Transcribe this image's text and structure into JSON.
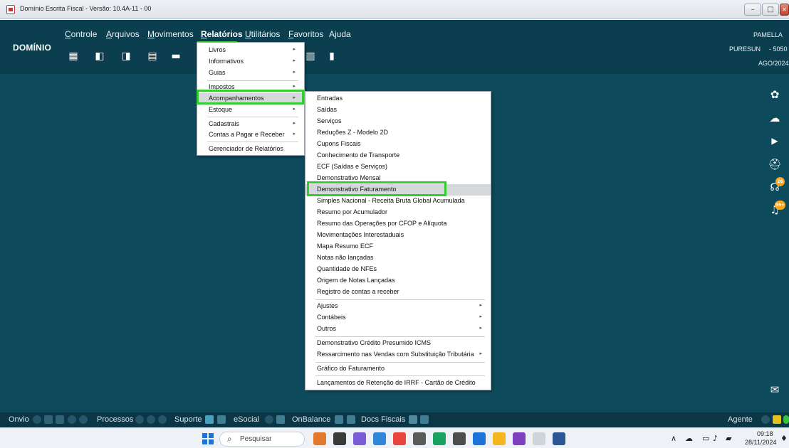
{
  "window": {
    "title": "Domínio Escrita Fiscal  - Versão: 10.4A-11 - 00",
    "min": "–",
    "max": "□",
    "close": "✕"
  },
  "brand": "DOMÍNIO",
  "menubar": [
    {
      "label": "Controle",
      "key": "C",
      "rest": "ontrole"
    },
    {
      "label": "Arquivos",
      "key": "A",
      "rest": "rquivos"
    },
    {
      "label": "Movimentos",
      "key": "M",
      "rest": "ovimentos"
    },
    {
      "label": "Relatórios",
      "key": "R",
      "rest": "elatórios",
      "active": true
    },
    {
      "label": "Utilitários",
      "key": "U",
      "rest": "tilitários"
    },
    {
      "label": "Favoritos",
      "key": "F",
      "rest": "avoritos"
    },
    {
      "label": "Ajuda",
      "key": "",
      "rest": "Ajuda"
    }
  ],
  "toolbar_icons": [
    "building-icon",
    "document-c-icon",
    "document-exit-icon",
    "document-money-icon",
    "printer-icon",
    "calendar-icon",
    "book-icon"
  ],
  "user": {
    "name": "PAMELLA",
    "company": "PURESUN",
    "company_code": "- 5050",
    "period": "AGO/2024"
  },
  "relatorios_menu": [
    {
      "label": "Livros",
      "submenu": true
    },
    {
      "label": "Informativos",
      "submenu": true
    },
    {
      "label": "Guias",
      "submenu": true
    },
    {
      "label": "Impostos",
      "submenu": true
    },
    {
      "label": "Acompanhamentos",
      "submenu": true,
      "highlighted": true
    },
    {
      "label": "Estoque",
      "submenu": true
    },
    {
      "label": "Cadastrais",
      "submenu": true
    },
    {
      "label": "Contas a Pagar e Receber",
      "submenu": true
    },
    {
      "label": "Gerenciador de Relatórios",
      "submenu": false
    }
  ],
  "acompanhamentos_menu": [
    {
      "label": "Entradas"
    },
    {
      "label": "Saídas"
    },
    {
      "label": "Serviços"
    },
    {
      "label": "Reduções Z - Modelo 2D"
    },
    {
      "label": "Cupons Fiscais"
    },
    {
      "label": "Conhecimento de Transporte"
    },
    {
      "label": "ECF (Saídas e Serviços)"
    },
    {
      "label": "Demonstrativo Mensal"
    },
    {
      "label": "Demonstrativo Faturamento",
      "highlighted": true
    },
    {
      "label": "Simples Nacional - Receita Bruta Global Acumulada"
    },
    {
      "label": "Resumo por Acumulador"
    },
    {
      "label": "Resumo das Operações por CFOP e Alíquota"
    },
    {
      "label": "Movimentações Interestaduais"
    },
    {
      "label": "Mapa Resumo ECF"
    },
    {
      "label": "Notas não lançadas"
    },
    {
      "label": "Quantidade de NFEs"
    },
    {
      "label": "Origem de Notas Lançadas"
    },
    {
      "label": "Registro de contas a receber"
    },
    {
      "label": "Ajustes",
      "submenu": true
    },
    {
      "label": "Contábeis",
      "submenu": true
    },
    {
      "label": "Outros",
      "submenu": true
    },
    {
      "label": "Demonstrativo Crédito Presumido ICMS"
    },
    {
      "label": "Ressarcimento nas Vendas com Substituição Tributária",
      "submenu": true
    },
    {
      "label": "Gráfico do Faturamento"
    },
    {
      "label": "Lançamentos de Retenção de IRRF - Cartão de Crédito"
    }
  ],
  "side_icons": [
    {
      "name": "gear-icon",
      "glyph": "✿"
    },
    {
      "name": "cloud-sync-icon",
      "glyph": "☁"
    },
    {
      "name": "play-icon",
      "glyph": "▶"
    },
    {
      "name": "robot-icon",
      "glyph": "⛑"
    },
    {
      "name": "headset-icon",
      "glyph": "☊",
      "badge": "26"
    },
    {
      "name": "bell-icon",
      "glyph": "♫",
      "badge": "99+"
    },
    {
      "name": "chat-icon",
      "glyph": "✉"
    }
  ],
  "statusbar": {
    "onvio": "Onvio",
    "processos": "Processos",
    "suporte": "Suporte",
    "esocial": "eSocial",
    "onbalance": "OnBalance",
    "docs_fiscais": "Docs Fiscais",
    "agente": "Agente"
  },
  "taskbar": {
    "search_placeholder": "Pesquisar",
    "time": "09:18",
    "date": "28/11/2024",
    "apps": [
      "#e37a2b",
      "#3a3a3a",
      "#7b5cd6",
      "#2f87d8",
      "#e8453c",
      "#5a5a5a",
      "#1aa260",
      "#4d4d4d",
      "#1b74d9",
      "#f6b71c",
      "#7f3fbf",
      "#cfd4d8",
      "#2b5797"
    ]
  },
  "colors": {
    "app_bg": "#0d4a5c",
    "header_bg": "#0b3f4f",
    "highlight_green": "#33cc33",
    "selection_gray": "#d6d9dc"
  }
}
